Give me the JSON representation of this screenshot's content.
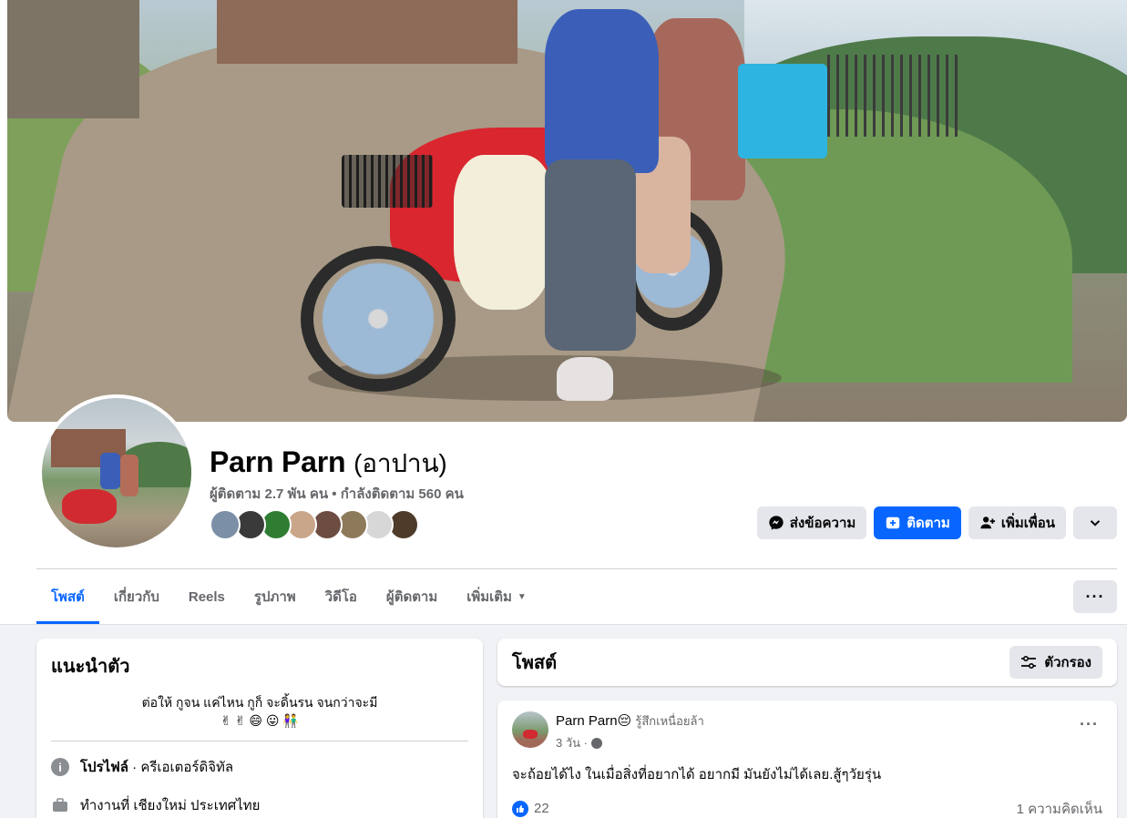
{
  "profile": {
    "name": "Parn Parn",
    "alt_name": "(อาปาน)",
    "meta": "ผู้ติดตาม 2.7 พัน คน • กำลังติดตาม 560 คน"
  },
  "friends_preview": [
    {
      "icon": "friend-avatar",
      "color": "#7b8fa6"
    },
    {
      "icon": "friend-avatar",
      "color": "#3a3a3a"
    },
    {
      "icon": "friend-avatar",
      "color": "#2e7d32"
    },
    {
      "icon": "friend-avatar",
      "color": "#c9a68a"
    },
    {
      "icon": "friend-avatar",
      "color": "#6d4c41"
    },
    {
      "icon": "friend-avatar",
      "color": "#8d7a5a"
    },
    {
      "icon": "friend-avatar",
      "color": "#d7d7d7"
    },
    {
      "icon": "friend-avatar",
      "color": "#4e3b2a"
    }
  ],
  "actions": {
    "message_label": "ส่งข้อความ",
    "follow_label": "ติดตาม",
    "add_friend_label": "เพิ่มเพื่อน"
  },
  "tabs": [
    {
      "label": "โพสต์"
    },
    {
      "label": "เกี่ยวกับ"
    },
    {
      "label": "Reels"
    },
    {
      "label": "รูปภาพ"
    },
    {
      "label": "วิดีโอ"
    },
    {
      "label": "ผู้ติดตาม"
    },
    {
      "label": "เพิ่มเติม"
    }
  ],
  "intro": {
    "title": "แนะนำตัว",
    "bio_line1": "ต่อให้ กูจน แค่ไหน กูก็ จะดิ้นรน จนกว่าจะมี",
    "bio_line2": "✌ ✌ 😄 😛 👫",
    "profile_label": "โปรไฟล์",
    "profile_value": " · ครีเอเตอร์ดิจิทัล",
    "work_value": "ทำงานที่ เชียงใหม่ ประเทศไทย"
  },
  "posts_header": {
    "title": "โพสต์",
    "filter_label": "ตัวกรอง"
  },
  "post": {
    "author": "Parn Parn😔",
    "feeling": "รู้สึกเหนื่อยล้า",
    "time": "3 วัน ·",
    "text": "จะถ้อยได้ไง ในเมื่อสิ่งที่อยากได้ อยากมี มันยังไม่ได้เลย.สู้ๆวัยรุ่น",
    "likes": "22",
    "comments": "1 ความคิดเห็น"
  },
  "colors": {
    "accent": "#0866ff",
    "button_gray": "#e4e6eb",
    "page_bg": "#f0f2f5"
  }
}
